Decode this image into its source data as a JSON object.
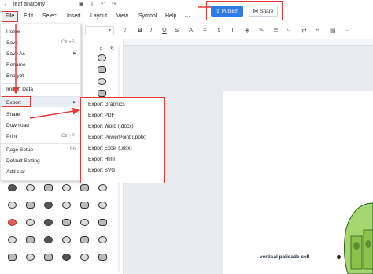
{
  "titlebar": {
    "back_icon": "chevron-left-icon",
    "title": "leaf anatomy",
    "icons": [
      "save-icon",
      "download-icon",
      "undo-icon",
      "redo-icon"
    ]
  },
  "menubar": {
    "items": [
      "File",
      "Edit",
      "Select",
      "Insert",
      "Layout",
      "View",
      "Symbol",
      "Help"
    ]
  },
  "actions": {
    "publish_label": "Publish",
    "share_label": "Share"
  },
  "file_menu": {
    "items": [
      {
        "label": "Home",
        "shortcut": "",
        "submenu": false
      },
      {
        "label": "Save",
        "shortcut": "Ctrl+S",
        "submenu": false
      },
      {
        "label": "Save As",
        "shortcut": "",
        "submenu": true
      },
      {
        "label": "Rename",
        "shortcut": "",
        "submenu": false
      },
      {
        "label": "Encrypt",
        "shortcut": "",
        "submenu": false
      },
      {
        "label": "Import Data",
        "shortcut": "",
        "submenu": false
      },
      {
        "label": "Export",
        "shortcut": "",
        "submenu": true
      },
      {
        "label": "Share",
        "shortcut": "",
        "submenu": false
      },
      {
        "label": "Download",
        "shortcut": "",
        "submenu": false
      },
      {
        "label": "Print",
        "shortcut": "Ctrl+P",
        "submenu": false
      },
      {
        "label": "Page Setup",
        "shortcut": "F6",
        "submenu": false
      },
      {
        "label": "Default Setting",
        "shortcut": "",
        "submenu": false
      },
      {
        "label": "Add star",
        "shortcut": "",
        "submenu": false
      }
    ]
  },
  "export_menu": {
    "items": [
      "Export Graphics",
      "Export PDF",
      "Export Word (.docx)",
      "Export PowerPoint (.pptx)",
      "Export Excel (.xlsx)",
      "Export Html",
      "Export SVG"
    ]
  },
  "canvas": {
    "callout_label": "vertical palisade cell"
  },
  "colors": {
    "highlight": "#e53935",
    "publish": "#2f7be8",
    "cell_green": "#8bc34a"
  }
}
